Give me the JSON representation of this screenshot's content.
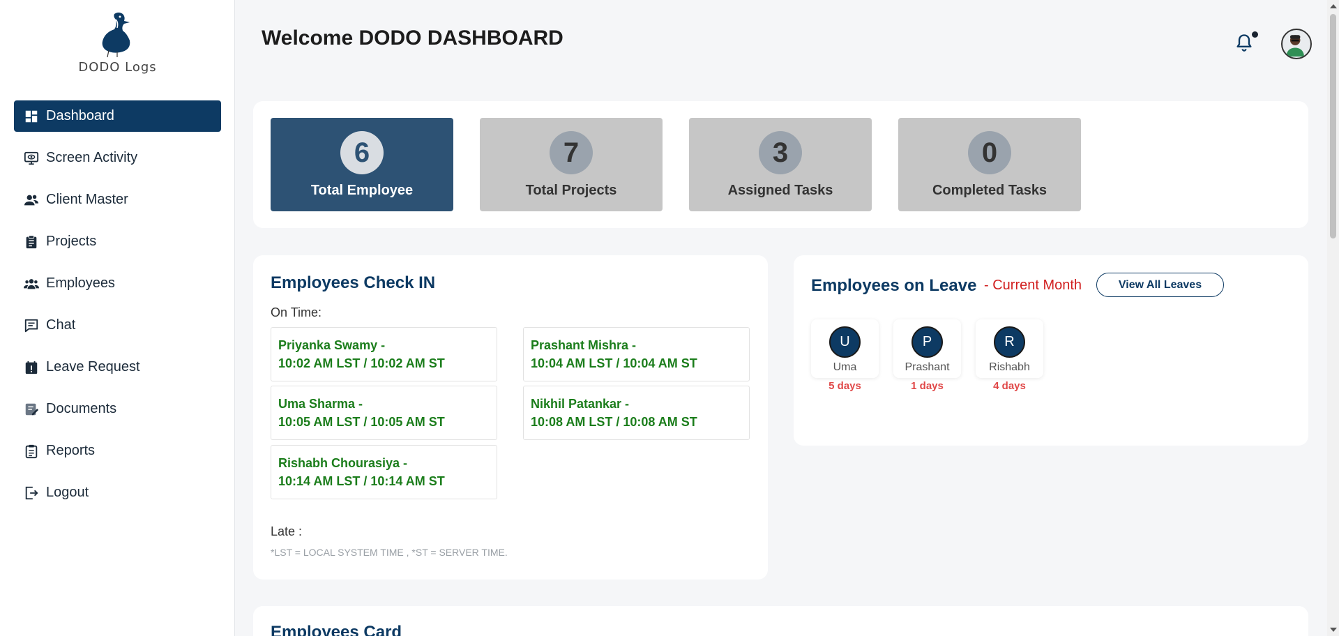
{
  "brand": {
    "logo_text": "DODO Logs"
  },
  "sidebar": {
    "items": [
      {
        "label": "Dashboard",
        "icon": "dashboard-icon",
        "active": true
      },
      {
        "label": "Screen Activity",
        "icon": "monitor-eye-icon"
      },
      {
        "label": "Client Master",
        "icon": "client-group-icon"
      },
      {
        "label": "Projects",
        "icon": "clipboard-icon"
      },
      {
        "label": "Employees",
        "icon": "employees-icon"
      },
      {
        "label": "Chat",
        "icon": "chat-icon"
      },
      {
        "label": "Leave Request",
        "icon": "calendar-alert-icon"
      },
      {
        "label": "Documents",
        "icon": "document-edit-icon"
      },
      {
        "label": "Reports",
        "icon": "report-icon"
      },
      {
        "label": "Logout",
        "icon": "logout-icon"
      }
    ]
  },
  "header": {
    "title": "Welcome DODO DASHBOARD"
  },
  "stats": [
    {
      "value": "6",
      "label": "Total Employee",
      "active": true
    },
    {
      "value": "7",
      "label": "Total Projects"
    },
    {
      "value": "3",
      "label": "Assigned Tasks"
    },
    {
      "value": "0",
      "label": "Completed Tasks"
    }
  ],
  "checkin": {
    "title": "Employees Check IN",
    "on_time_label": "On Time:",
    "on_time": [
      {
        "name": "Priyanka Swamy -",
        "time": "10:02 AM LST / 10:02 AM ST"
      },
      {
        "name": "Prashant Mishra -",
        "time": "10:04 AM LST / 10:04 AM ST"
      },
      {
        "name": "Uma Sharma -",
        "time": "10:05 AM LST / 10:05 AM ST"
      },
      {
        "name": "Nikhil Patankar -",
        "time": "10:08 AM LST / 10:08 AM ST"
      },
      {
        "name": "Rishabh Chourasiya -",
        "time": "10:14 AM LST / 10:14 AM ST"
      }
    ],
    "late_label": "Late :",
    "note": "*LST = LOCAL SYSTEM TIME , *ST = SERVER TIME."
  },
  "leave": {
    "title": "Employees on Leave",
    "subtitle": "- Current Month",
    "view_all_label": "View All Leaves",
    "items": [
      {
        "initial": "U",
        "name": "Uma",
        "days": "5 days"
      },
      {
        "initial": "P",
        "name": "Prashant",
        "days": "1 days"
      },
      {
        "initial": "R",
        "name": "Rishabh",
        "days": "4 days"
      }
    ]
  },
  "employees_card": {
    "title": "Employees Card"
  },
  "colors": {
    "primary": "#0d3a63",
    "active_stat": "#2d5274",
    "inactive_stat": "#c6c6c6",
    "on_time_text": "#1b7d1b",
    "leave_days": "#e04848"
  }
}
